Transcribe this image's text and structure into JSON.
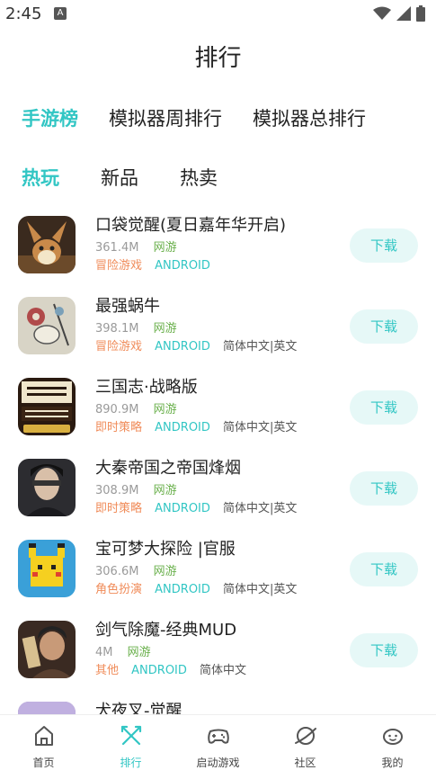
{
  "status": {
    "time": "2:45",
    "notif_icon": "A"
  },
  "header": {
    "title": "排行"
  },
  "tabs": [
    {
      "label": "手游榜",
      "active": true
    },
    {
      "label": "模拟器周排行",
      "active": false
    },
    {
      "label": "模拟器总排行",
      "active": false
    }
  ],
  "subtabs": [
    {
      "label": "热玩",
      "active": true
    },
    {
      "label": "新品",
      "active": false
    },
    {
      "label": "热卖",
      "active": false
    }
  ],
  "apps": [
    {
      "name": "口袋觉醒(夏日嘉年华开启)",
      "size": "361.4M",
      "type": "网游",
      "genre": "冒险游戏",
      "platform": "ANDROID",
      "lang": "",
      "button": "下载",
      "icon": "eevee-icon"
    },
    {
      "name": "最强蜗牛",
      "size": "398.1M",
      "type": "网游",
      "genre": "冒险游戏",
      "platform": "ANDROID",
      "lang": "简体中文|英文",
      "button": "下载",
      "icon": "snail-icon"
    },
    {
      "name": "三国志·战略版",
      "size": "890.9M",
      "type": "网游",
      "genre": "即时策略",
      "platform": "ANDROID",
      "lang": "简体中文|英文",
      "button": "下载",
      "icon": "sanguo-icon"
    },
    {
      "name": "大秦帝国之帝国烽烟",
      "size": "308.9M",
      "type": "网游",
      "genre": "即时策略",
      "platform": "ANDROID",
      "lang": "简体中文|英文",
      "button": "下载",
      "icon": "warrior-icon"
    },
    {
      "name": "宝可梦大探险 |官服",
      "size": "306.6M",
      "type": "网游",
      "genre": "角色扮演",
      "platform": "ANDROID",
      "lang": "简体中文|英文",
      "button": "下载",
      "icon": "pikachu-icon"
    },
    {
      "name": "剑气除魔-经典MUD",
      "size": "4M",
      "type": "网游",
      "genre": "其他",
      "platform": "ANDROID",
      "lang": "简体中文",
      "button": "下载",
      "icon": "taoist-icon"
    },
    {
      "name": "犬夜叉-觉醒",
      "size": "",
      "type": "",
      "genre": "",
      "platform": "",
      "lang": "",
      "button": "",
      "icon": "inuyasha-icon"
    }
  ],
  "bottom_nav": [
    {
      "label": "首页",
      "icon": "home-icon",
      "active": false
    },
    {
      "label": "排行",
      "icon": "ranking-icon",
      "active": true
    },
    {
      "label": "启动游戏",
      "icon": "gamepad-icon",
      "active": false
    },
    {
      "label": "社区",
      "icon": "community-icon",
      "active": false
    },
    {
      "label": "我的",
      "icon": "profile-icon",
      "active": false
    }
  ],
  "colors": {
    "accent": "#32c6c4",
    "type_green": "#6ab04c",
    "genre_orange": "#f08c5a",
    "button_bg": "#e6f8f7"
  }
}
